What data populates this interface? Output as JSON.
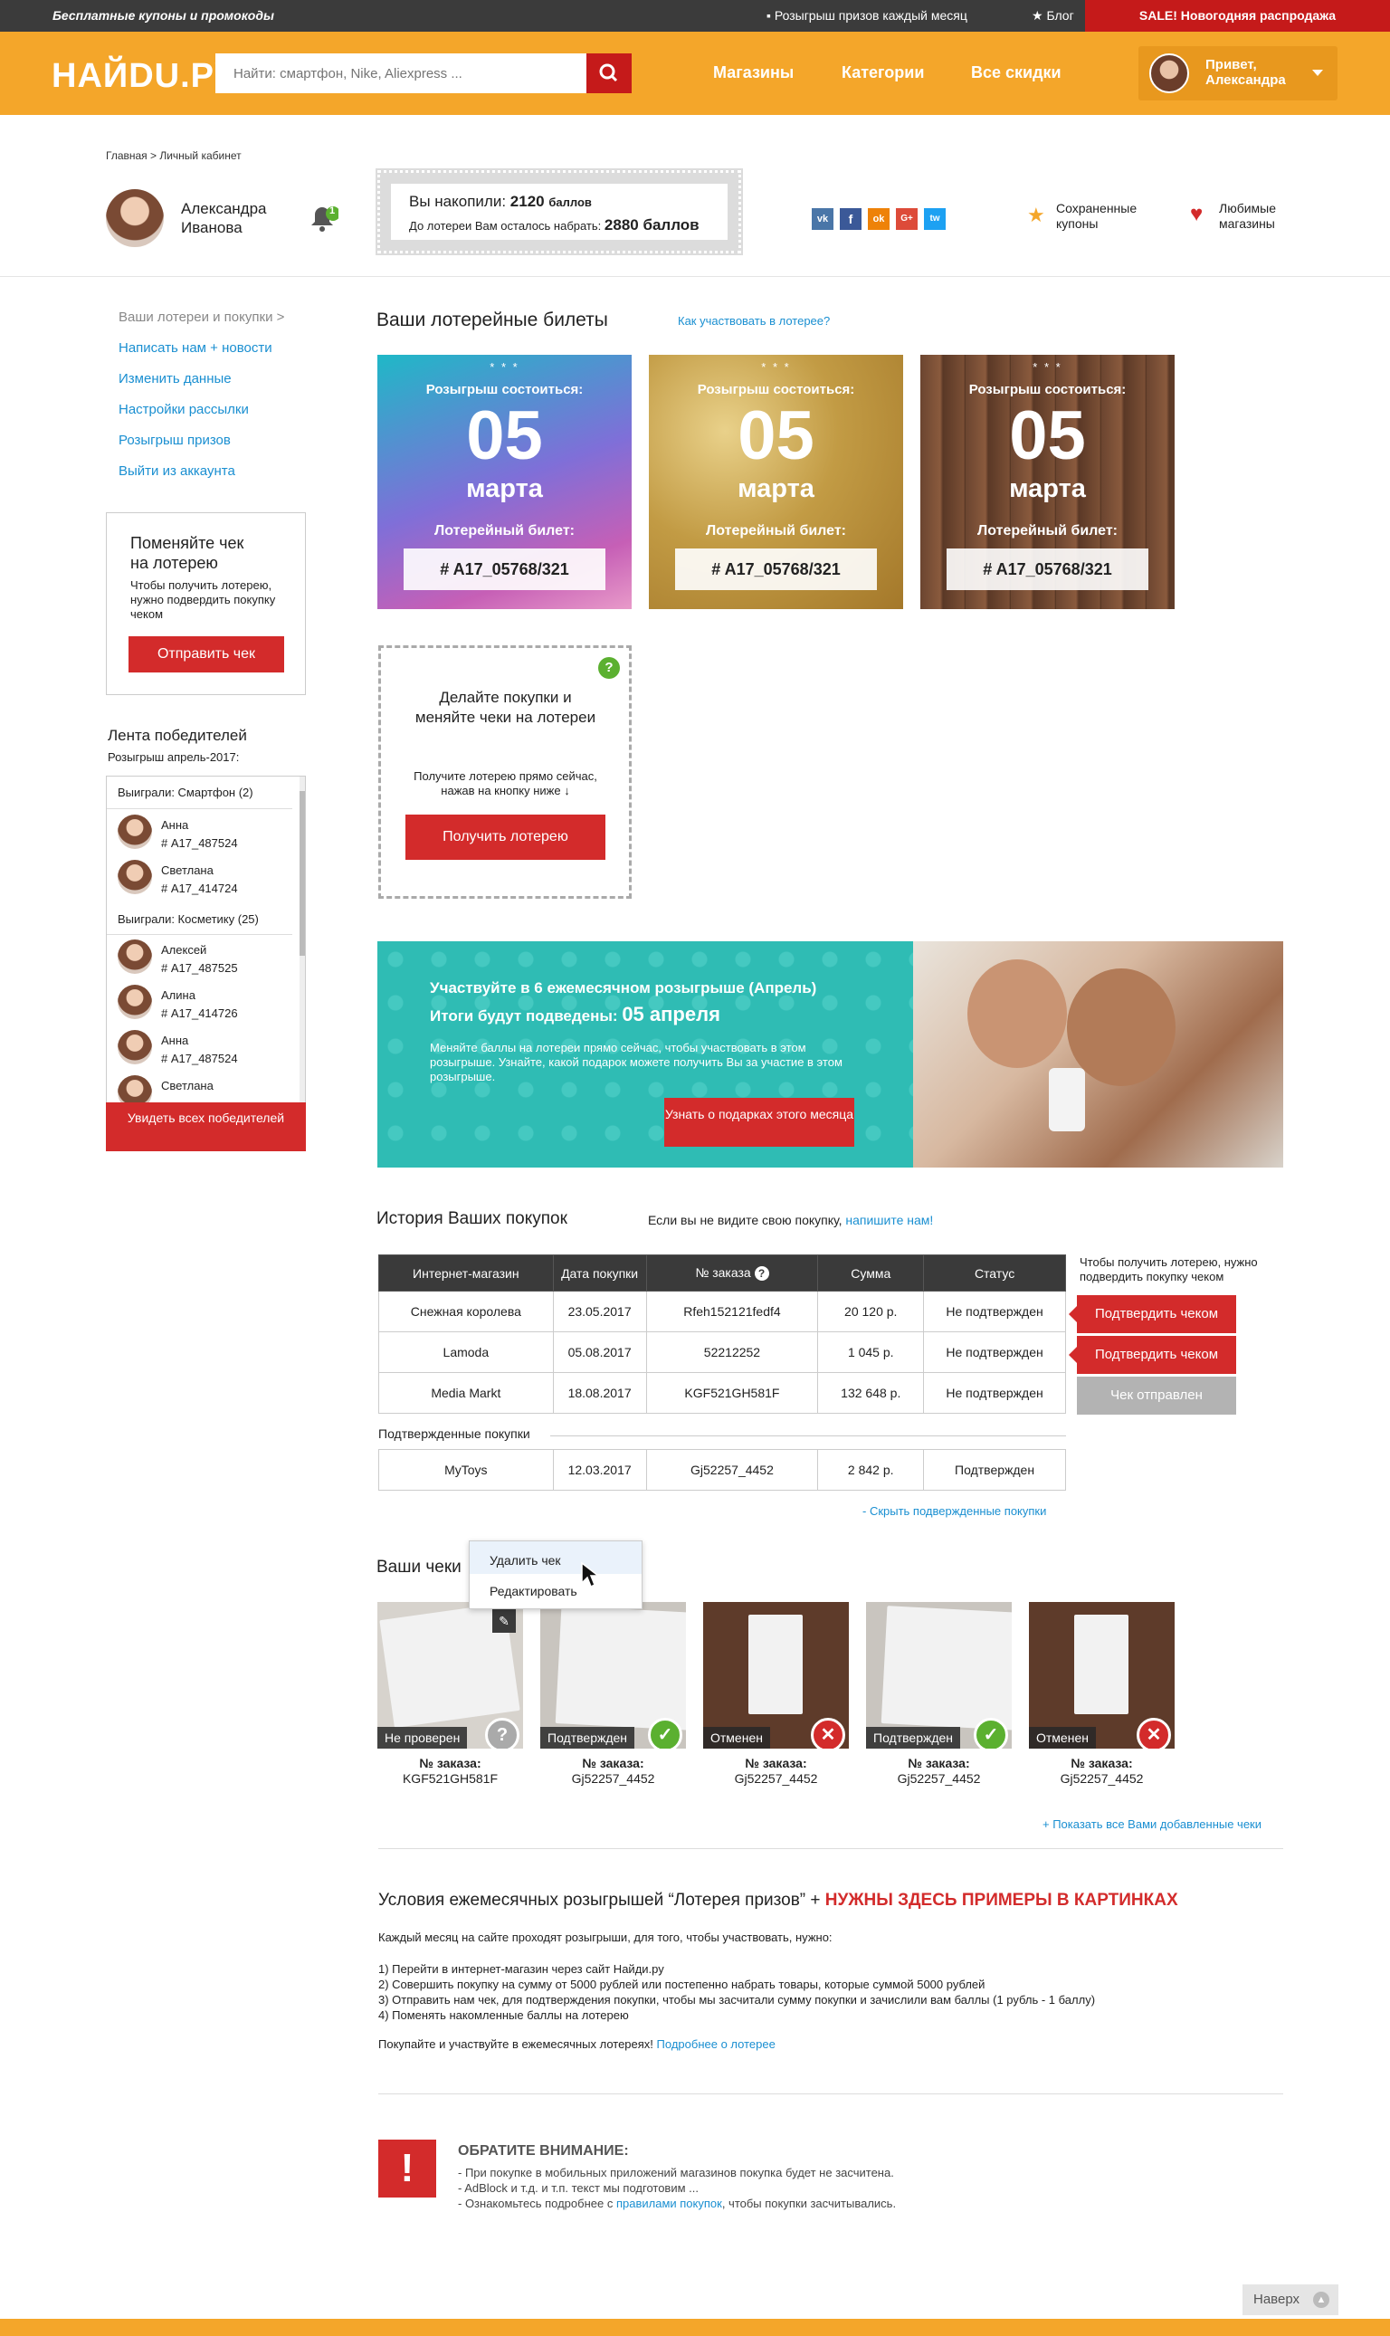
{
  "topbar": {
    "promo": "Бесплатные купоны и промокоды",
    "lottery": "Розыгрыш призов каждый месяц",
    "blog": "Блог",
    "sale": "SALE! Новогодняя распродажа"
  },
  "header": {
    "logo": "НАЙDU.PY",
    "search_placeholder": "Найти: смартфон, Nike, Aliexpress ...",
    "nav": [
      "Магазины",
      "Категории",
      "Все скидки"
    ],
    "user_greeting": "Привет,",
    "user_name": "Александра"
  },
  "breadcrumb": "Главная > Личный кабинет",
  "profile": {
    "first": "Александра",
    "last": "Иванова",
    "notifications": "1"
  },
  "points": {
    "label": "Вы накопили:",
    "value": "2120",
    "unit": "баллов",
    "remain_label": "До лотереи Вам осталось набрать:",
    "remain_value": "2880 баллов"
  },
  "social": [
    "vk",
    "f",
    "ok",
    "G+",
    "tw"
  ],
  "quick_links": {
    "saved": "Сохраненные купоны",
    "favorites": "Любимые магазины"
  },
  "sidebar": {
    "links": [
      "Ваши лотереи и покупки >",
      "Написать нам + новости",
      "Изменить данные",
      "Настройки рассылки",
      "Розыгрыш призов",
      "Выйти из аккаунта"
    ],
    "exchange": {
      "title": "Поменяйте чек на лотерею",
      "text": "Чтобы получить лотерею, нужно подвердить покупку чеком",
      "button": "Отправить чек"
    },
    "winners": {
      "title": "Лента победителей",
      "sub": "Розыгрыш апрель-2017:",
      "cat1": "Выиграли: Смартфон (2)",
      "cat2": "Выиграли: Косметику (25)",
      "list1": [
        {
          "name": "Анна",
          "code": "# A17_487524"
        },
        {
          "name": "Светлана",
          "code": "# A17_414724"
        }
      ],
      "list2": [
        {
          "name": "Алексей",
          "code": "# A17_487525"
        },
        {
          "name": "Алина",
          "code": "# A17_414726"
        },
        {
          "name": "Анна",
          "code": "# A17_487524"
        },
        {
          "name": "Светлана",
          "code": ""
        }
      ],
      "button": "Увидеть всех победителей"
    }
  },
  "tickets": {
    "title": "Ваши лотерейные билеты",
    "how": "Как участвовать в лотерее?",
    "items": [
      {
        "stars": "* * *",
        "draw": "Розыгрыш состоиться:",
        "day": "05",
        "month": "марта",
        "ticket_label": "Лотерейный билет:",
        "number": "# A17_05768/321"
      },
      {
        "stars": "* * *",
        "draw": "Розыгрыш состоиться:",
        "day": "05",
        "month": "марта",
        "ticket_label": "Лотерейный билет:",
        "number": "# A17_05768/321"
      },
      {
        "stars": "* * *",
        "draw": "Розыгрыш состоиться:",
        "day": "05",
        "month": "марта",
        "ticket_label": "Лотерейный билет:",
        "number": "# A17_05768/321"
      }
    ],
    "cta": {
      "title": "Делайте покупки и меняйте чеки на лотереи",
      "text": "Получите лотерею прямо сейчас, нажав на кнопку ниже ↓",
      "button": "Получить лотерею"
    }
  },
  "banner": {
    "line1": "Участвуйте в 6 ежемесячном розыгрыше (Апрель)",
    "line2": "Итоги будут подведены:",
    "date": "05 апреля",
    "text": "Меняйте баллы на лотереи прямо сейчас, чтобы участвовать в этом розыгрыше. Узнайте, какой подарок можете получить Вы за участие в этом розыгрыше.",
    "button": "Узнать о подарках этого месяца"
  },
  "history": {
    "title": "История Ваших покупок",
    "hint": "Если вы не видите свою покупку,",
    "hint_link": "напишите нам!",
    "columns": [
      "Интернет-магазин",
      "Дата покупки",
      "№ заказа",
      "Сумма",
      "Статус"
    ],
    "rows": [
      [
        "Снежная королева",
        "23.05.2017",
        "Rfeh152121fedf4",
        "20 120 р.",
        "Не подтвержден"
      ],
      [
        "Lamoda",
        "05.08.2017",
        "52212252",
        "1 045 р.",
        "Не подтвержден"
      ],
      [
        "Media Markt",
        "18.08.2017",
        "KGF521GH581F",
        "132 648 р.",
        "Не подтвержден"
      ]
    ],
    "confirm_note": "Чтобы получить лотерею, нужно подвердить покупку чеком",
    "actions": [
      "Подтвердить чеком",
      "Подтвердить чеком",
      "Чек отправлен"
    ],
    "confirmed_title": "Подтвержденные покупки",
    "confirmed_rows": [
      [
        "MyToys",
        "12.03.2017",
        "Gj52257_4452",
        "2 842 р.",
        "Подтвержден"
      ]
    ],
    "hide_link": "- Скрыть подвержденные покупки"
  },
  "receipts": {
    "title": "Ваши чеки",
    "menu": [
      "Удалить чек",
      "Редактировать"
    ],
    "order_label": "№ заказа:",
    "items": [
      {
        "status": "Не проверен",
        "order": "KGF521GH581F",
        "badge": "?"
      },
      {
        "status": "Подтвержден",
        "order": "Gj52257_4452",
        "badge": "✓"
      },
      {
        "status": "Отменен",
        "order": "Gj52257_4452",
        "badge": "✕"
      },
      {
        "status": "Подтвержден",
        "order": "Gj52257_4452",
        "badge": "✓"
      },
      {
        "status": "Отменен",
        "order": "Gj52257_4452",
        "badge": "✕"
      }
    ],
    "show_all": "+ Показать все Вами добавленные чеки"
  },
  "conditions": {
    "title": "Условия ежемесячных розыгрышей “Лотерея призов” +",
    "title_red": "НУЖНЫ ЗДЕСЬ ПРИМЕРЫ В КАРТИНКАХ",
    "intro": "Каждый месяц на сайте проходят розыгрыши, для того, чтобы участвовать, нужно:",
    "steps": [
      "1) Перейти в интернет-магазин через сайт Найди.ру",
      "2) Совершить покупку на сумму от 5000 рублей или постепенно набрать товары, которые суммой 5000 рублей",
      "3) Отправить нам чек, для подтверждения покупки, чтобы мы засчитали сумму покупки и зачислили вам баллы (1 рубль - 1 баллу)",
      "4) Поменять накомленные баллы на лотерею"
    ],
    "outro": "Покупайте и участвуйте в ежемесячных лотереях!",
    "outro_link": "Подробнее о лотерее"
  },
  "attention": {
    "title": "ОБРАТИТЕ ВНИМАНИЕ:",
    "l1": "- При покупке в мобильных приложений магазинов покупка будет не засчитена.",
    "l2": "- AdBlock и т.д. и т.п. текст мы подготовим ...",
    "l3_pre": "- Ознакомьтесь подробнее с",
    "l3_link": "правилами покупок",
    "l3_post": ", чтобы покупки засчитывались."
  },
  "to_top": "Наверх",
  "colors": {
    "orange": "#f4a62a",
    "red": "#d32b2b",
    "blue": "#1a8fd1",
    "teal": "#2bbdb6"
  }
}
